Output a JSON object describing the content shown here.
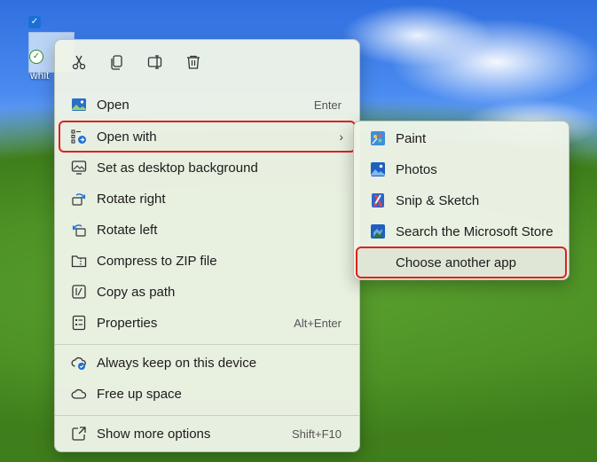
{
  "desktop": {
    "file_name": "whit",
    "checkbox_glyph": "✓",
    "sync_glyph": "✓"
  },
  "toolbar": {
    "cut_icon": "scissors-icon",
    "copy_icon": "copy-icon",
    "rename_icon": "rename-icon",
    "delete_icon": "trash-icon"
  },
  "menu": {
    "items": [
      {
        "label": "Open",
        "shortcut": "Enter",
        "icon": "image-icon"
      },
      {
        "label": "Open with",
        "chevron": "›",
        "icon": "open-with-icon",
        "highlighted": true
      },
      {
        "label": "Set as desktop background",
        "icon": "desktop-background-icon"
      },
      {
        "label": "Rotate right",
        "icon": "rotate-right-icon"
      },
      {
        "label": "Rotate left",
        "icon": "rotate-left-icon"
      },
      {
        "label": "Compress to ZIP file",
        "icon": "zip-folder-icon"
      },
      {
        "label": "Copy as path",
        "icon": "copy-path-icon"
      },
      {
        "label": "Properties",
        "shortcut": "Alt+Enter",
        "icon": "properties-icon"
      },
      {
        "label": "Always keep on this device",
        "icon": "cloud-keep-icon"
      },
      {
        "label": "Free up space",
        "icon": "cloud-icon"
      },
      {
        "label": "Show more options",
        "shortcut": "Shift+F10",
        "icon": "more-options-icon"
      }
    ]
  },
  "submenu": {
    "items": [
      {
        "label": "Paint",
        "icon": "paint-icon"
      },
      {
        "label": "Photos",
        "icon": "photos-icon"
      },
      {
        "label": "Snip & Sketch",
        "icon": "snip-sketch-icon"
      },
      {
        "label": "Search the Microsoft Store",
        "icon": "store-icon"
      },
      {
        "label": "Choose another app",
        "selected": true,
        "highlighted": true
      }
    ]
  },
  "colors": {
    "highlight_border": "#e02020",
    "accent": "#1a6fd6",
    "menu_bg": "#eef4e8"
  }
}
